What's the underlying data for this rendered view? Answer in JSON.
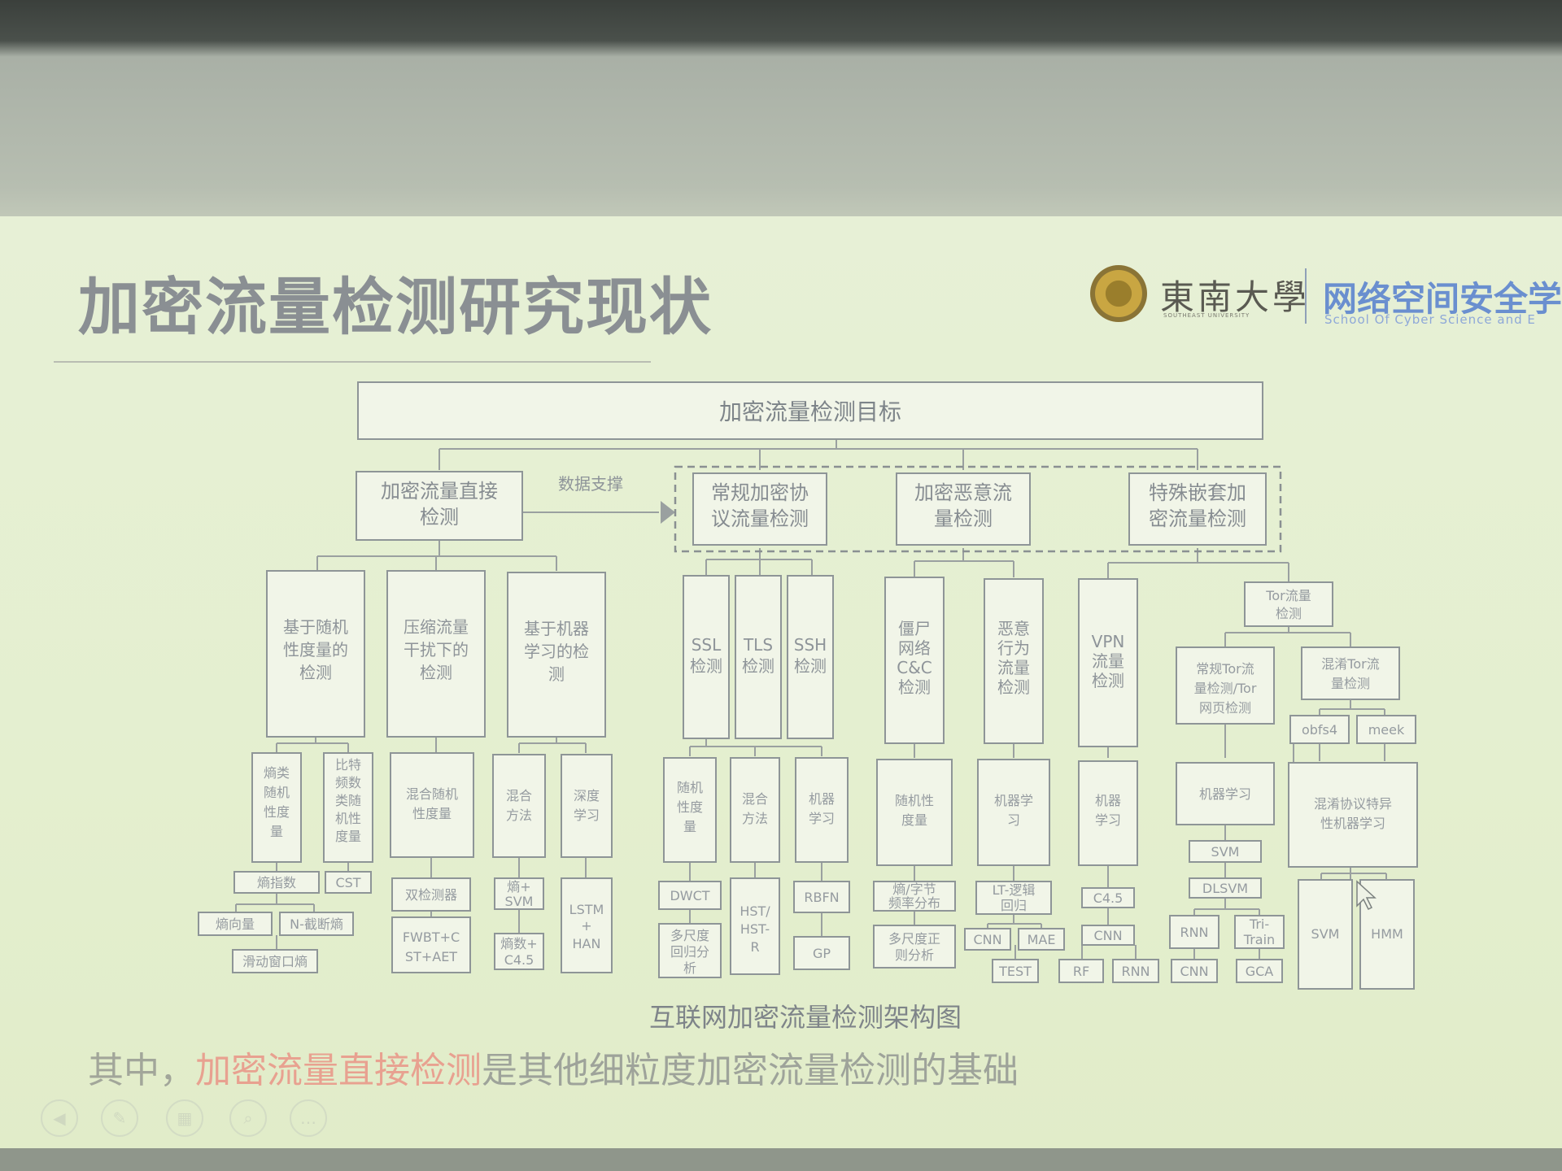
{
  "slide": {
    "title": "加密流量检测研究现状",
    "university_name": "東南大學",
    "university_subtitle": "SOUTHEAST UNIVERSITY",
    "school_name": "网络空间安全学",
    "school_subtitle": "School Of Cyber Science and E"
  },
  "diagram": {
    "root": "加密流量检测目标",
    "support_label": "数据支撑",
    "branches": [
      {
        "label": [
          "加密流量直接",
          "检测"
        ],
        "children": [
          {
            "label": [
              "基于随机",
              "性度量的",
              "检测"
            ],
            "children": [
              {
                "label": [
                  "熵类",
                  "随机",
                  "性度",
                  "量"
                ],
                "methods": [
                  "熵指数",
                  "熵向量",
                  "N-截断熵",
                  "滑动窗口熵"
                ]
              },
              {
                "label": [
                  "比特",
                  "频数",
                  "类随",
                  "机性",
                  "度量"
                ],
                "methods": [
                  "CST"
                ]
              }
            ]
          },
          {
            "label": [
              "压缩流量",
              "干扰下的",
              "检测"
            ],
            "children": [
              {
                "label": [
                  "混合随机",
                  "性度量"
                ],
                "methods": [
                  "双检测器",
                  "FWBT+C",
                  "ST+AET"
                ]
              }
            ]
          },
          {
            "label": [
              "基于机器",
              "学习的检",
              "测"
            ],
            "children": [
              {
                "label": [
                  "混合",
                  "方法"
                ],
                "methods": [
                  "熵+",
                  "SVM",
                  "熵数+",
                  "C4.5"
                ]
              },
              {
                "label": [
                  "深度",
                  "学习"
                ],
                "methods": [
                  "LSTM",
                  "+",
                  "HAN"
                ]
              }
            ]
          }
        ]
      },
      {
        "label": [
          "常规加密协",
          "议流量检测"
        ],
        "children": [
          {
            "label": [
              "SSL",
              "检测"
            ]
          },
          {
            "label": [
              "TLS",
              "检测"
            ]
          },
          {
            "label": [
              "SSH",
              "检测"
            ]
          }
        ],
        "methods_groups": [
          {
            "label": [
              "随机",
              "性度",
              "量"
            ],
            "methods": [
              "DWCT",
              "多尺度",
              "回归分",
              "析"
            ]
          },
          {
            "label": [
              "混合",
              "方法"
            ],
            "methods": [
              "HST/",
              "HST-",
              "R"
            ]
          },
          {
            "label": [
              "机器",
              "学习"
            ],
            "methods": [
              "RBFN",
              "GP"
            ]
          }
        ]
      },
      {
        "label": [
          "加密恶意流",
          "量检测"
        ],
        "children": [
          {
            "label": [
              "僵尸",
              "网络",
              "C&C",
              "检测"
            ],
            "sub": {
              "label": [
                "随机性",
                "度量"
              ],
              "methods": [
                "熵/字节",
                "频率分布",
                "多尺度正",
                "则分析"
              ]
            }
          },
          {
            "label": [
              "恶意",
              "行为",
              "流量",
              "检测"
            ],
            "sub": {
              "label": [
                "机器学",
                "习"
              ],
              "methods": [
                "LT-逻辑",
                "回归",
                "CNN",
                "MAE",
                "TEST"
              ]
            }
          }
        ]
      },
      {
        "label": [
          "特殊嵌套加",
          "密流量检测"
        ],
        "children": [
          {
            "label": [
              "VPN",
              "流量",
              "检测"
            ],
            "sub": {
              "label": [
                "机器",
                "学习"
              ],
              "methods": [
                "C4.5",
                "CNN",
                "RF",
                "RNN"
              ]
            }
          },
          {
            "label": [
              "Tor流量",
              "检测"
            ],
            "children": [
              {
                "label": [
                  "常规Tor流",
                  "量检测/Tor",
                  "网页检测"
                ],
                "sub": {
                  "label": [
                    "机器学习"
                  ],
                  "methods": [
                    "SVM",
                    "DLSVM",
                    "RNN",
                    "Tri-",
                    "Train",
                    "CNN",
                    "GCA"
                  ]
                }
              },
              {
                "label": [
                  "混淆Tor流",
                  "量检测"
                ],
                "protocols": [
                  "obfs4",
                  "meek"
                ],
                "sub": {
                  "label": [
                    "混淆协议特异",
                    "性机器学习"
                  ],
                  "methods": [
                    "SVM",
                    "HMM"
                  ]
                }
              }
            ]
          }
        ]
      }
    ],
    "caption": "互联网加密流量检测架构图"
  },
  "footer": {
    "prefix": "其中，",
    "highlight": "加密流量直接检测",
    "suffix": "是其他细粒度加密流量检测的基础"
  },
  "colors": {
    "slide_background": "#e4efcf",
    "title": "#8a8f93",
    "highlight": "#e8a190",
    "school": "#6a8fcf",
    "box_stroke": "#8e9597"
  }
}
